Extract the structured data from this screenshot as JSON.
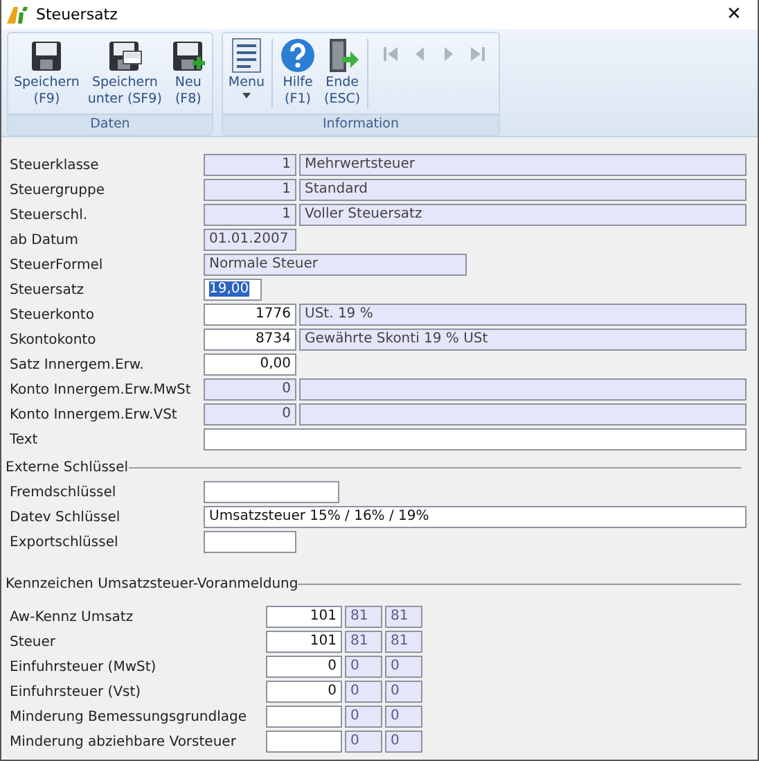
{
  "window": {
    "title": "Steuersatz",
    "close": "✕"
  },
  "ribbon": {
    "groups": [
      {
        "label": "Daten",
        "buttons": [
          {
            "kind": "save",
            "label": "Speichern\n(F9)"
          },
          {
            "kind": "save_as",
            "label": "Speichern\nunter (SF9)"
          },
          {
            "kind": "new",
            "label": "Neu\n(F8)"
          }
        ]
      },
      {
        "label": "Information",
        "buttons": [
          {
            "kind": "menu",
            "label": "Menu"
          },
          {
            "kind": "help",
            "label": "Hilfe\n(F1)"
          },
          {
            "kind": "exit",
            "label": "Ende\n(ESC)"
          }
        ],
        "navigation": [
          {
            "kind": "first",
            "disabled": true
          },
          {
            "kind": "prev",
            "disabled": true
          },
          {
            "kind": "next",
            "disabled": true
          },
          {
            "kind": "last",
            "disabled": true
          }
        ]
      }
    ]
  },
  "fields": [
    {
      "label": "Steuerklasse",
      "kind": "code_desc",
      "code": {
        "value": "1",
        "editable": false
      },
      "desc": {
        "value": "Mehrwertsteuer",
        "editable": false
      }
    },
    {
      "label": "Steuergruppe",
      "kind": "code_desc",
      "code": {
        "value": "1",
        "editable": false
      },
      "desc": {
        "value": "Standard",
        "editable": false
      }
    },
    {
      "label": "Steuerschl.",
      "kind": "code_desc",
      "code": {
        "value": "1",
        "editable": false
      },
      "desc": {
        "value": "Voller Steuersatz",
        "editable": false
      }
    },
    {
      "label": "ab Datum",
      "kind": "date",
      "code": {
        "value": "01.01.2007",
        "editable": false
      }
    },
    {
      "label": "SteuerFormel",
      "kind": "formula",
      "code": {
        "value": "Normale Steuer",
        "editable": false
      }
    },
    {
      "label": "Steuersatz",
      "kind": "rate",
      "code": {
        "value": "19,00",
        "editable": true,
        "text_selected": true
      }
    },
    {
      "label": "Steuerkonto",
      "kind": "code_desc",
      "code": {
        "value": "1776",
        "editable": true
      },
      "desc": {
        "value": "USt. 19 %",
        "editable": false
      }
    },
    {
      "label": "Skontokonto",
      "kind": "code_desc",
      "code": {
        "value": "8734",
        "editable": true
      },
      "desc": {
        "value": "Gewährte Skonti 19 % USt",
        "editable": false
      }
    },
    {
      "label": "Satz Innergem.Erw.",
      "kind": "number",
      "code": {
        "value": "0,00",
        "editable": true
      }
    },
    {
      "label": "Konto Innergem.Erw.MwSt",
      "kind": "code_desc",
      "code": {
        "value": "0",
        "editable": false
      },
      "desc": {
        "editable": false
      }
    },
    {
      "label": "Konto Innergem.Erw.VSt",
      "kind": "code_desc",
      "code": {
        "value": "0",
        "editable": false
      },
      "desc": {
        "editable": false
      }
    },
    {
      "label": "Text",
      "kind": "text",
      "code": {
        "editable": true
      }
    }
  ],
  "external_keys": {
    "title": "Externe Schlüssel",
    "fields": [
      {
        "label": "Fremdschlüssel",
        "kind": "medium"
      },
      {
        "label": "Datev Schlüssel",
        "kind": "full",
        "value": "Umsatzsteuer 15% / 16% / 19%"
      },
      {
        "label": "Exportschlüssel",
        "kind": "short"
      }
    ]
  },
  "vat_codes": {
    "title": "Kennzeichen Umsatzsteuer-Voranmeldung",
    "rows": [
      {
        "label": "Aw-Kennz Umsatz",
        "main": "101",
        "codes": [
          "81",
          "81"
        ]
      },
      {
        "label": "Steuer",
        "main": "101",
        "codes": [
          "81",
          "81"
        ]
      },
      {
        "label": "Einfuhrsteuer (MwSt)",
        "main": "0",
        "codes": [
          "0",
          "0"
        ]
      },
      {
        "label": "Einfuhrsteuer (Vst)",
        "main": "0",
        "codes": [
          "0",
          "0"
        ]
      },
      {
        "label": "Minderung Bemessungsgrundlage",
        "codes": [
          "0",
          "0"
        ]
      },
      {
        "label": "Minderung abziehbare Vorsteuer",
        "codes": [
          "0",
          "0"
        ]
      }
    ]
  }
}
